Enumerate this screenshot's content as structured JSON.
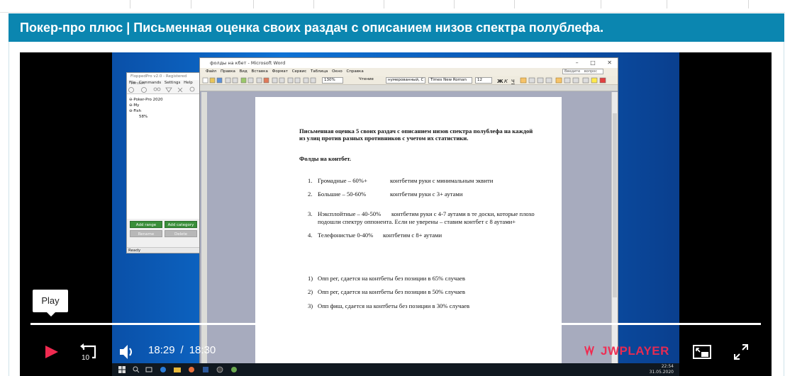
{
  "header": {
    "title": "Покер-про плюс | Письменная оценка своих раздач с описанием низов спектра полублефа."
  },
  "player": {
    "tooltip": "Play",
    "current_time": "18:29",
    "separator": "/",
    "duration": "18:30",
    "progress_fraction": 0.998,
    "brand": "JWPLAYER",
    "accent": "#f02a50"
  },
  "desktop": {
    "clock_time": "22:54",
    "clock_date": "31.05.2020",
    "tree_window": {
      "title": "FloppedPro v2.0 - Registered version",
      "menu": [
        "File",
        "Commands",
        "Settings",
        "Help"
      ],
      "nodes": [
        "Poker-Pro 2020",
        "My",
        "Fish",
        "58%"
      ],
      "buttons": {
        "add_range": "Add range",
        "add_category": "Add category",
        "rename": "Rename",
        "delete": "Delete"
      },
      "status": "Ready"
    },
    "word": {
      "title": "фолды на кбет - Microsoft Word",
      "menu": [
        "Файл",
        "Правка",
        "Вид",
        "Вставка",
        "Формат",
        "Сервис",
        "Таблица",
        "Окно",
        "Справка"
      ],
      "help_placeholder": "Введите вопрос",
      "zoom": "130%",
      "style": "нумерованный, С",
      "font": "Times New Roman",
      "size": "12",
      "reading": "Чтение",
      "doc": {
        "heading_line1": "Письменная оценка 5 своих раздач с описанием низов спектра полублефа на каждой",
        "heading_line2": "из улиц против разных противников с учетом их статистики.",
        "section": "Фолды на контбет.",
        "items": [
          {
            "n": "1.",
            "left": "Громадные – 60%+",
            "right": "контбетим руки с минимальным эквити"
          },
          {
            "n": "2.",
            "left": "Большие – 50-60%",
            "right": "контбетим руки с 3+ аутами"
          },
          {
            "n": "3.",
            "left": "Нэксплойтные – 40-50%",
            "right": "контбетим руки с 4-7 аутами в те доски, которые плохо",
            "line2": "подошли спектру оппонента. Если не уверены – ставим контбет с 8 аутами+"
          },
          {
            "n": "4.",
            "left": "Телефонистые 0-40%",
            "right": "контбетим с 8+ аутами"
          }
        ],
        "stats": [
          {
            "n": "1)",
            "text": "Опп рег, сдается на контбеты без позиции в 65% случаев"
          },
          {
            "n": "2)",
            "text": "Опп рег, сдается на контбеты без позиции в 50% случаев"
          },
          {
            "n": "3)",
            "text": "Опп фиш, сдается на контбеты без позиции в 30% случаев"
          }
        ]
      }
    }
  }
}
